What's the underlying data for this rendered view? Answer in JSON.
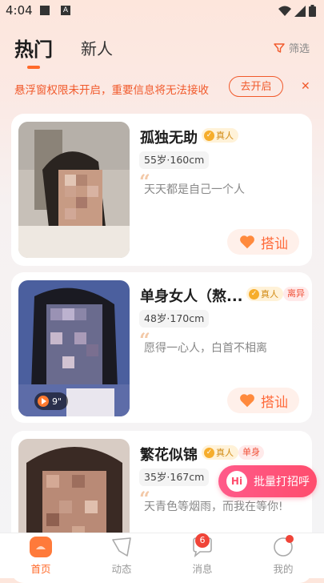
{
  "status_bar": {
    "time": "4:04"
  },
  "header": {
    "tab_hot": "热门",
    "tab_new": "新人",
    "filter_label": "筛选"
  },
  "notice": {
    "text": "悬浮窗权限未开启，重要信息将无法接收",
    "button": "去开启"
  },
  "cards": [
    {
      "name": "孤独无助",
      "real_badge": "真人",
      "info": "55岁·160cm",
      "motto": "天天都是自己一个人",
      "chat_label": "搭讪"
    },
    {
      "name": "单身女人（熬...",
      "real_badge": "真人",
      "status": "离异",
      "info": "48岁·170cm",
      "motto": "愿得一心人，白首不相离",
      "chat_label": "搭讪",
      "video_duration": "9\""
    },
    {
      "name": "繁花似锦",
      "real_badge": "真人",
      "status": "单身",
      "info": "35岁·167cm",
      "motto": "天青色等烟雨，而我在等你!"
    }
  ],
  "floating": {
    "hi": "Hi",
    "label": "批量打招呼"
  },
  "bottom_nav": {
    "home": "首页",
    "moments": "动态",
    "messages": "消息",
    "messages_count": "6",
    "mine": "我的"
  },
  "colors": {
    "accent": "#ff6a2a",
    "notice": "#f15a2c",
    "greet": "#ff4d6d"
  }
}
